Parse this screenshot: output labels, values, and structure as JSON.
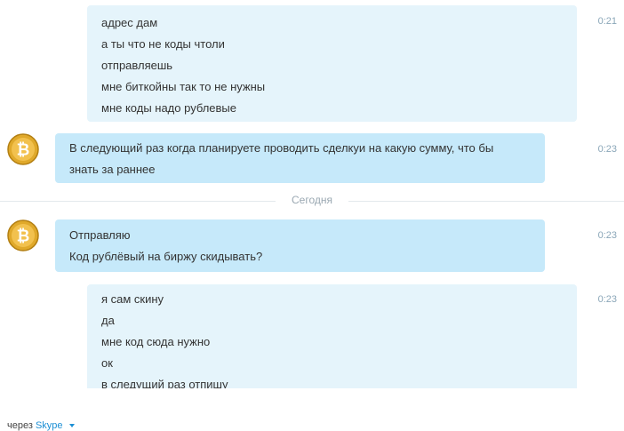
{
  "messages": [
    {
      "lines": [
        "адрес дам",
        "а ты что не коды чтоли",
        "отправляешь",
        "мне биткойны так то не нужны",
        "мне коды надо рублевые"
      ],
      "time": "0:21"
    },
    {
      "lines": [
        "В следующий раз когда планируете проводить сделкуи на какую сумму, что бы",
        "знать за раннее"
      ],
      "time": "0:23"
    },
    {
      "lines": [
        "Отправляю",
        "Код рублёвый на биржу скидывать?"
      ],
      "time": "0:23"
    },
    {
      "lines": [
        "я сам скину",
        "да",
        "мне код сюда нужно",
        "ок",
        "в следущий раз отпишу"
      ],
      "time": "0:23"
    }
  ],
  "divider": {
    "label": "Сегодня"
  },
  "footer": {
    "prefix": "через",
    "link": "Skype"
  },
  "colors": {
    "outgoing_bubble": "#e5f4fb",
    "incoming_bubble": "#c6e9fa",
    "time": "#8aa6b8",
    "link": "#1c8fd4"
  }
}
